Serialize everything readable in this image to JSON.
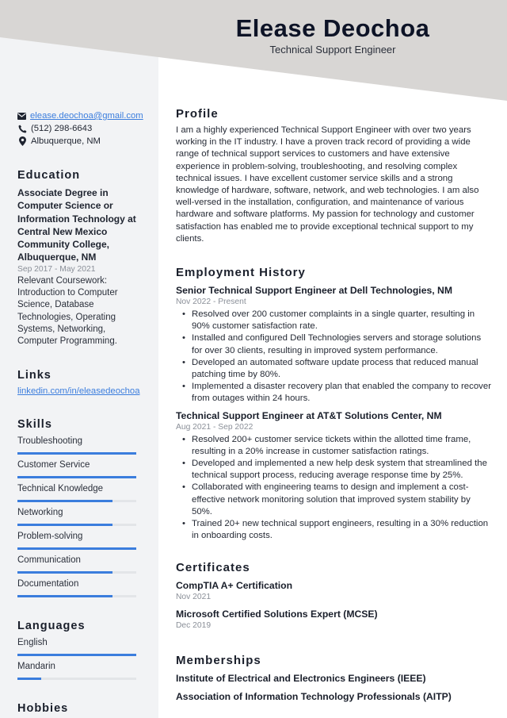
{
  "header": {
    "name": "Elease Deochoa",
    "title": "Technical Support Engineer"
  },
  "colors": {
    "header_bg": "#d8d6d4",
    "sidebar_bg": "#f2f3f5",
    "accent": "#3b7ddd"
  },
  "contact": {
    "email": "elease.deochoa@gmail.com",
    "phone": "(512) 298-6643",
    "location": "Albuquerque, NM",
    "icons": [
      "envelope-icon",
      "phone-icon",
      "map-pin-icon"
    ]
  },
  "education": {
    "heading": "Education",
    "degree": "Associate Degree in Computer Science or Information Technology at Central New Mexico Community College, Albuquerque, NM",
    "dates": "Sep 2017 - May 2021",
    "coursework": "Relevant Coursework: Introduction to Computer Science, Database Technologies, Operating Systems, Networking, Computer Programming."
  },
  "links": {
    "heading": "Links",
    "items": [
      "linkedin.com/in/eleasedeochoa"
    ]
  },
  "skills": {
    "heading": "Skills",
    "items": [
      {
        "label": "Troubleshooting",
        "level": 1.0
      },
      {
        "label": "Customer Service",
        "level": 1.0
      },
      {
        "label": "Technical Knowledge",
        "level": 0.8
      },
      {
        "label": "Networking",
        "level": 0.8
      },
      {
        "label": "Problem-solving",
        "level": 1.0
      },
      {
        "label": "Communication",
        "level": 0.8
      },
      {
        "label": "Documentation",
        "level": 0.8
      }
    ]
  },
  "languages": {
    "heading": "Languages",
    "items": [
      {
        "label": "English",
        "level": 1.0
      },
      {
        "label": "Mandarin",
        "level": 0.2
      }
    ]
  },
  "hobbies": {
    "heading": "Hobbies"
  },
  "profile": {
    "heading": "Profile",
    "text": "I am a highly experienced Technical Support Engineer with over two years working in the IT industry. I have a proven track record of providing a wide range of technical support services to customers and have extensive experience in problem-solving, troubleshooting, and resolving complex technical issues. I have excellent customer service skills and a strong knowledge of hardware, software, network, and web technologies. I am also well-versed in the installation, configuration, and maintenance of various hardware and software platforms. My passion for technology and customer satisfaction has enabled me to provide exceptional technical support to my clients."
  },
  "employment": {
    "heading": "Employment History",
    "jobs": [
      {
        "title": "Senior Technical Support Engineer at Dell Technologies, NM",
        "dates": "Nov 2022 - Present",
        "bullets": [
          "Resolved over 200 customer complaints in a single quarter, resulting in 90% customer satisfaction rate.",
          "Installed and configured Dell Technologies servers and storage solutions for over 30 clients, resulting in improved system performance.",
          "Developed an automated software update process that reduced manual patching time by 80%.",
          "Implemented a disaster recovery plan that enabled the company to recover from outages within 24 hours."
        ]
      },
      {
        "title": "Technical Support Engineer at AT&T Solutions Center, NM",
        "dates": "Aug 2021 - Sep 2022",
        "bullets": [
          "Resolved 200+ customer service tickets within the allotted time frame, resulting in a 20% increase in customer satisfaction ratings.",
          "Developed and implemented a new help desk system that streamlined the technical support process, reducing average response time by 25%.",
          "Collaborated with engineering teams to design and implement a cost-effective network monitoring solution that improved system stability by 50%.",
          "Trained 20+ new technical support engineers, resulting in a 30% reduction in onboarding costs."
        ]
      }
    ]
  },
  "certificates": {
    "heading": "Certificates",
    "items": [
      {
        "name": "CompTIA A+ Certification",
        "date": "Nov 2021"
      },
      {
        "name": "Microsoft Certified Solutions Expert (MCSE)",
        "date": "Dec 2019"
      }
    ]
  },
  "memberships": {
    "heading": "Memberships",
    "items": [
      "Institute of Electrical and Electronics Engineers (IEEE)",
      "Association of Information Technology Professionals (AITP)"
    ]
  }
}
